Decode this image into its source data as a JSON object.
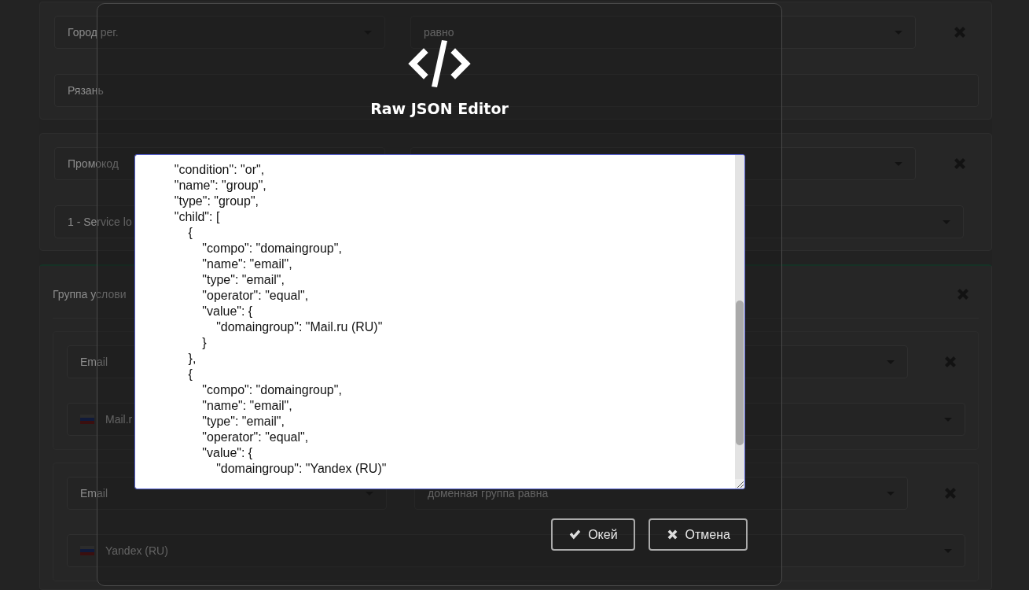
{
  "form": {
    "cards": [
      {
        "kind": "condition",
        "field": "Город рег.",
        "operator": "равно",
        "value": {
          "kind": "input",
          "text": "Рязань"
        }
      },
      {
        "kind": "condition",
        "field": "Промокод",
        "value": {
          "kind": "select",
          "text": "1 - Service lo"
        }
      },
      {
        "kind": "group",
        "title": "Группа услови",
        "children": [
          {
            "field": "Email",
            "value": "Mail.r",
            "flag": true
          },
          {
            "field": "Email",
            "operator": "доменная группа равна",
            "value": "Yandex (RU)",
            "flag": true
          }
        ]
      }
    ]
  },
  "modal": {
    "title": "Raw JSON Editor",
    "editor": {
      "value": "    \"condition\": \"or\",\n    \"name\": \"group\",\n    \"type\": \"group\",\n    \"child\": [\n        {\n            \"compo\": \"domaingroup\",\n            \"name\": \"email\",\n            \"type\": \"email\",\n            \"operator\": \"equal\",\n            \"value\": {\n                \"domaingroup\": \"Mail.ru (RU)\"\n            }\n        },\n        {\n            \"compo\": \"domaingroup\",\n            \"name\": \"email\",\n            \"type\": \"email\",\n            \"operator\": \"equal\",\n            \"value\": {\n                \"domaingroup\": \"Yandex (RU)\""
    },
    "buttons": [
      {
        "kind": "ok",
        "label": "Окей"
      },
      {
        "kind": "cancel",
        "label": "Отмена"
      }
    ]
  }
}
